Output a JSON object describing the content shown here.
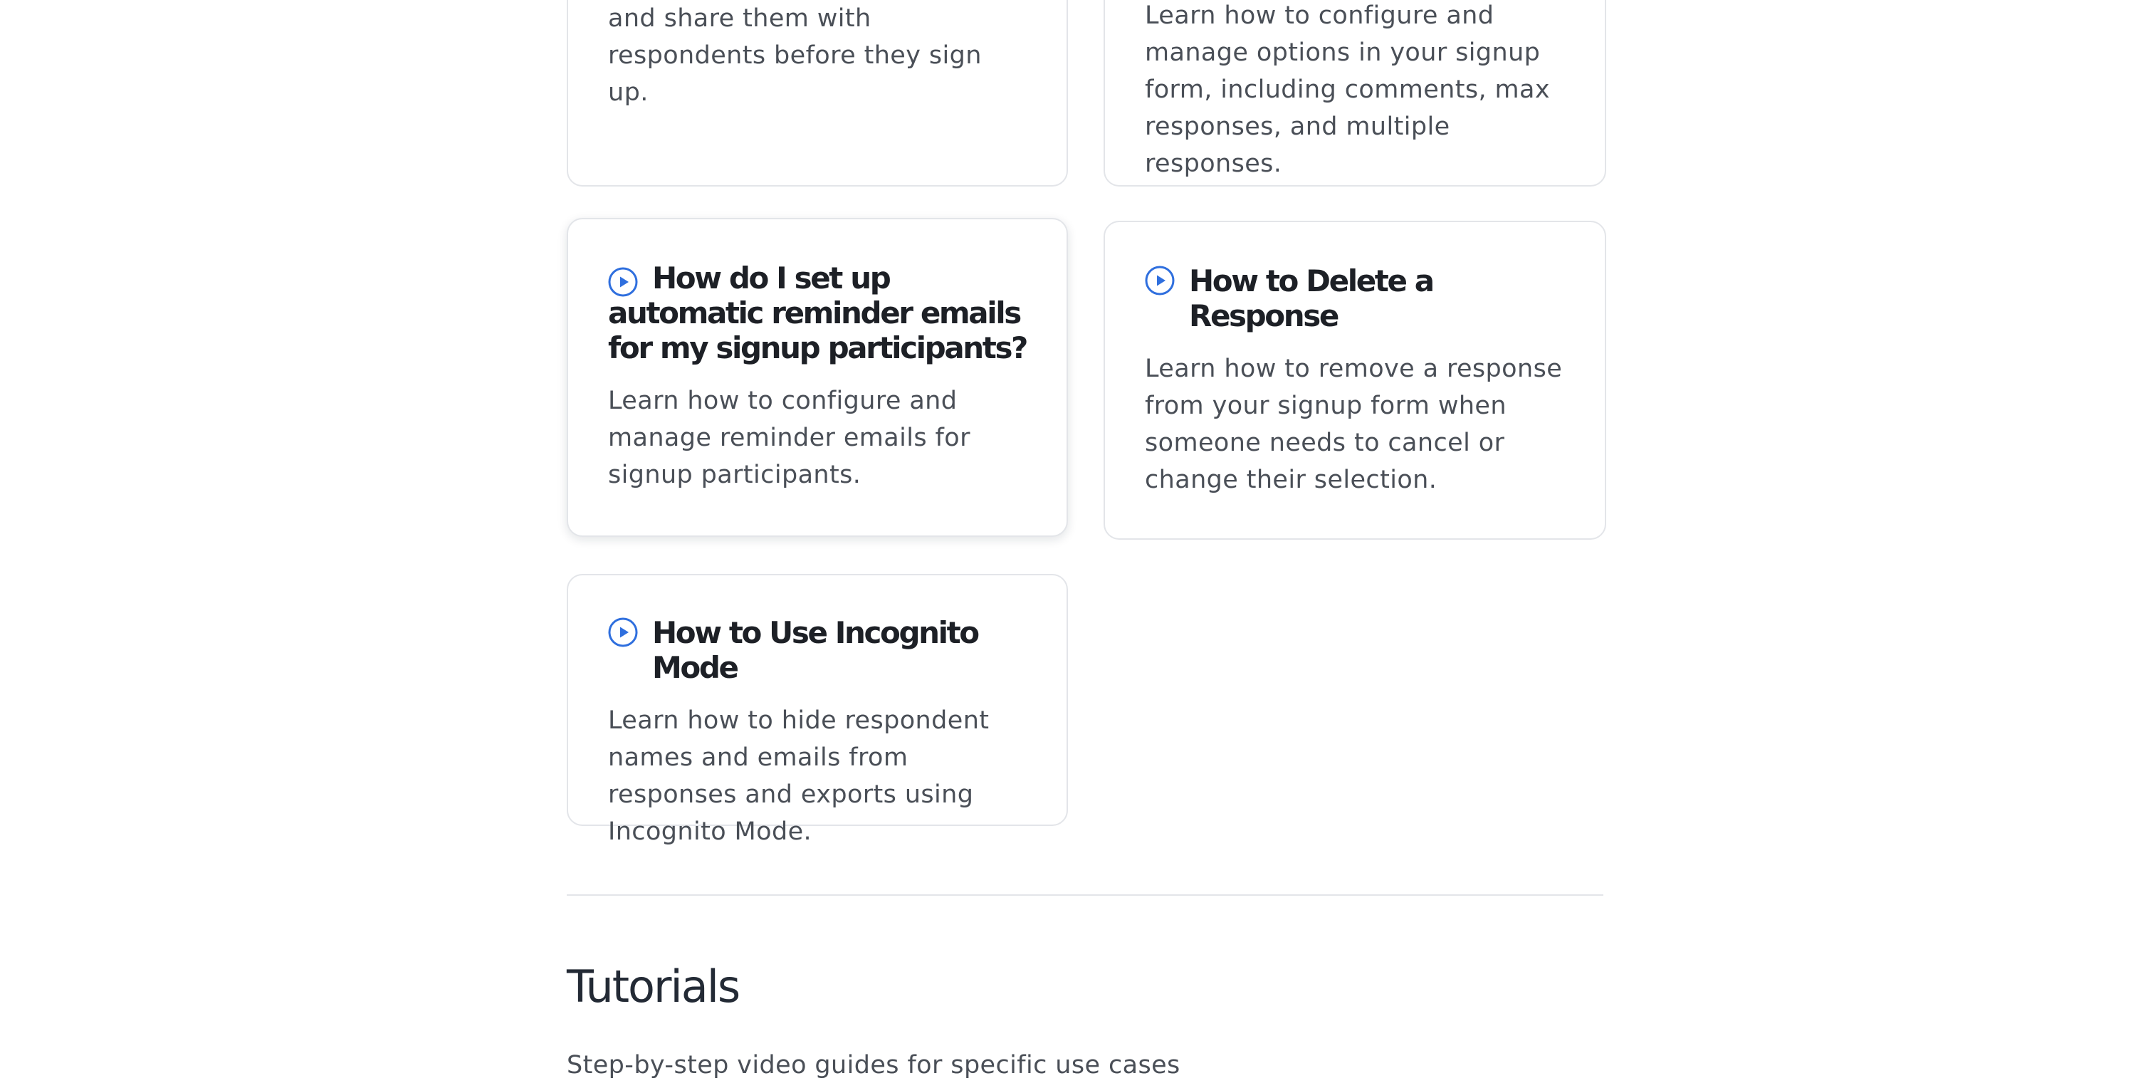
{
  "accent_color": "#2f6fde",
  "cards": [
    {
      "title": "",
      "description": "and share them with respondents before they sign up.",
      "icon": "play-circle-icon"
    },
    {
      "title": "",
      "description": "Learn how to configure and manage options in your signup form, including comments, max responses, and multiple responses.",
      "icon": "play-circle-icon"
    },
    {
      "title": "How do I set up automatic reminder emails for my signup participants?",
      "description": "Learn how to configure and manage reminder emails for signup participants.",
      "icon": "play-circle-icon"
    },
    {
      "title": "How to Delete a Response",
      "description": "Learn how to remove a response from your signup form when someone needs to cancel or change their selection.",
      "icon": "play-circle-icon"
    },
    {
      "title": "How to Use Incognito Mode",
      "description": "Learn how to hide respondent names and emails from responses and exports using Incognito Mode.",
      "icon": "play-circle-icon"
    }
  ],
  "tutorials": {
    "heading": "Tutorials",
    "subheading": "Step-by-step video guides for specific use cases"
  }
}
